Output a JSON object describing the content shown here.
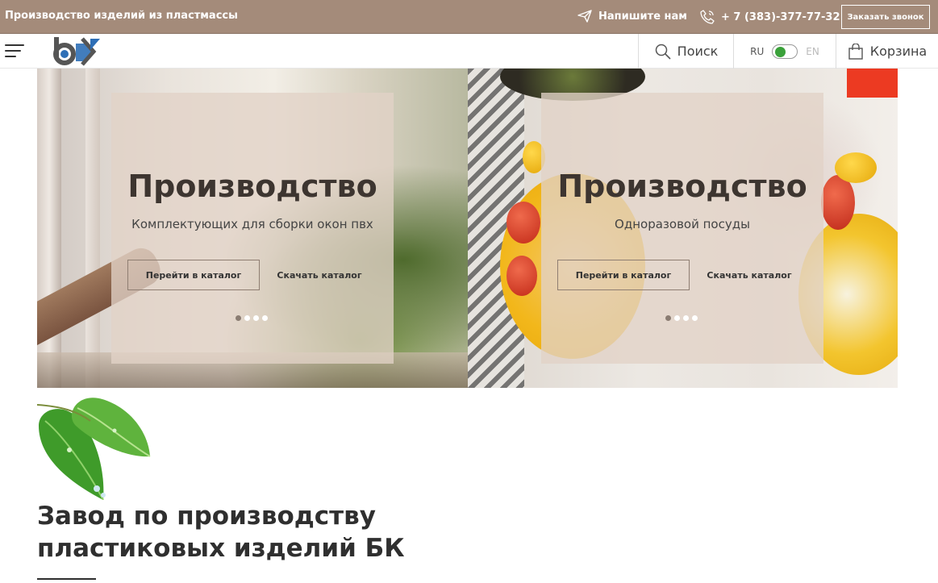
{
  "topbar": {
    "company": "Производство изделий из пластмассы",
    "write_label": "Напишите нам",
    "phone": "+ 7 (383)-377-77-32",
    "callback_label": "Заказать звонок",
    "write_icon": "paper-plane-icon",
    "phone_icon": "phone-icon"
  },
  "header": {
    "logo_text": "БК",
    "search_label": "Поиск",
    "lang_ru": "RU",
    "lang_en": "EN",
    "cart_label": "Корзина",
    "lang_selected": "RU"
  },
  "banners": [
    {
      "title": "Производство",
      "subtitle": "Комплектующих для сборки окон пвх",
      "catalog_label": "Перейти в каталог",
      "download_label": "Скачать каталог",
      "slides": 4,
      "active_slide": 1
    },
    {
      "title": "Производство",
      "subtitle": "Одноразовой посуды",
      "catalog_label": "Перейти в каталог",
      "download_label": "Скачать каталог",
      "slides": 4,
      "active_slide": 1
    }
  ],
  "about": {
    "title_line1": "Завод по производству",
    "title_line2": "пластиковых изделий БК"
  },
  "colors": {
    "topbar_bg": "#a48b7a",
    "toggle_green": "#3aa13a"
  }
}
